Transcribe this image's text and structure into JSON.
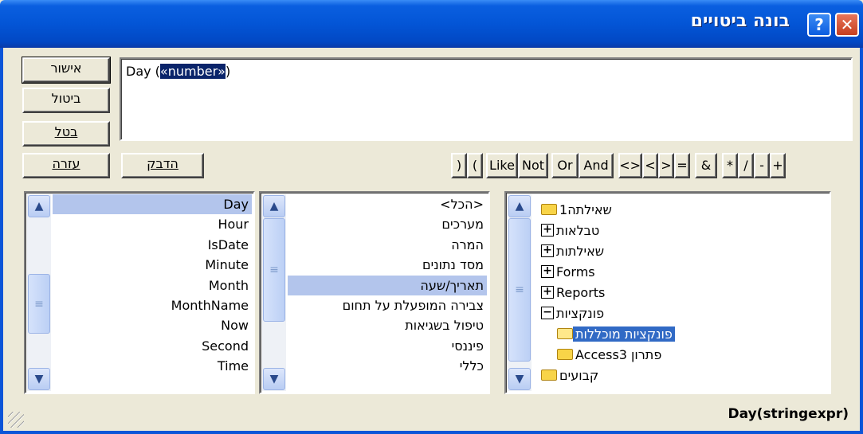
{
  "window": {
    "title": "בונה ביטויים",
    "help_icon": "question-mark-icon",
    "close_icon": "close-icon",
    "help_glyph": "?",
    "close_glyph": "✕"
  },
  "buttons": {
    "ok": "אישור",
    "cancel": "ביטול",
    "undo": "בטל",
    "help": "עזרה",
    "paste": "הדבק"
  },
  "expression": {
    "prefix": "Day (",
    "placeholder_arg": "«number»",
    "suffix": ")"
  },
  "operators": [
    "(",
    ")",
    "Like",
    "Not",
    "Or",
    "And",
    "<>",
    ">",
    "<",
    "=",
    "&",
    "*",
    "/",
    "-",
    "+"
  ],
  "tree": {
    "items": [
      {
        "label": "שאילתה1",
        "icon": "folder-icon",
        "expander": ""
      },
      {
        "label": "טבלאות",
        "icon": "expand-plus-icon",
        "expander": "+"
      },
      {
        "label": "שאילתות",
        "icon": "expand-plus-icon",
        "expander": "+"
      },
      {
        "label": "Forms",
        "icon": "expand-plus-icon",
        "expander": "+"
      },
      {
        "label": "Reports",
        "icon": "expand-plus-icon",
        "expander": "+"
      },
      {
        "label": "פונקציות",
        "icon": "collapse-minus-icon",
        "expander": "−"
      },
      {
        "label": "פונקציות מוכללות",
        "icon": "open-folder-icon",
        "expander": "",
        "selected": true
      },
      {
        "label": "Access3 פתרון",
        "icon": "folder-icon",
        "expander": ""
      },
      {
        "label": "קבועים",
        "icon": "folder-icon",
        "expander": ""
      }
    ]
  },
  "categories": {
    "items": [
      "<הכל>",
      "מערכים",
      "המרה",
      "מסד נתונים",
      "תאריך/שעה",
      "צבירה המופעלת על תחום",
      "טיפול בשגיאות",
      "פיננסי",
      "כללי"
    ],
    "selected": "תאריך/שעה"
  },
  "functions": {
    "items": [
      "Day",
      "Hour",
      "IsDate",
      "Minute",
      "Month",
      "MonthName",
      "Now",
      "Second",
      "Time"
    ],
    "selected": "Day"
  },
  "scrollbar": {
    "up_glyph": "▲",
    "down_glyph": "▼",
    "thumb_glyph": "≡"
  },
  "status": {
    "syntax": "Day(stringexpr)"
  }
}
